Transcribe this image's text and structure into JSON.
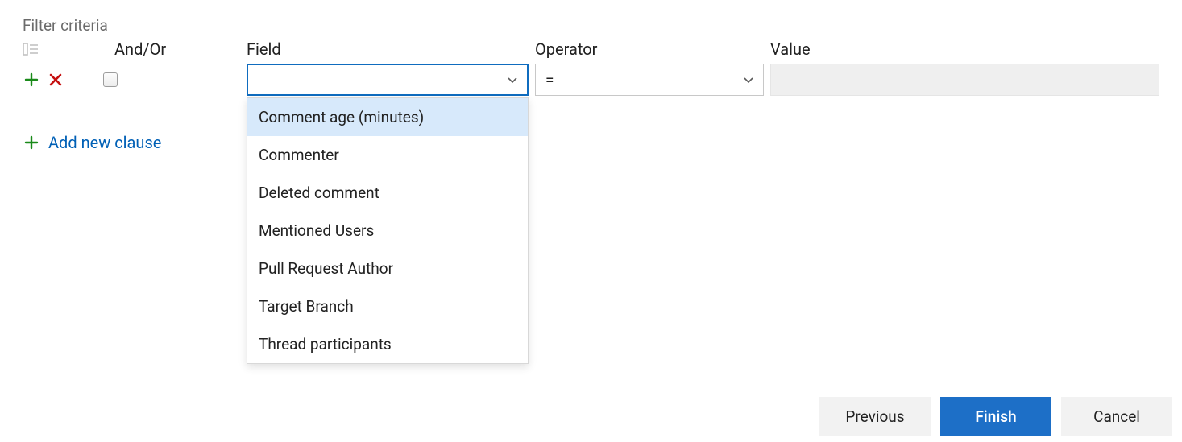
{
  "title": "Filter criteria",
  "headers": {
    "andor": "And/Or",
    "field": "Field",
    "operator": "Operator",
    "value": "Value"
  },
  "row": {
    "field_selected": "",
    "operator_selected": "=",
    "value": ""
  },
  "field_options": [
    "Comment age (minutes)",
    "Commenter",
    "Deleted comment",
    "Mentioned Users",
    "Pull Request Author",
    "Target Branch",
    "Thread participants"
  ],
  "field_highlight_index": 0,
  "add_clause_label": "Add new clause",
  "buttons": {
    "previous": "Previous",
    "finish": "Finish",
    "cancel": "Cancel"
  }
}
